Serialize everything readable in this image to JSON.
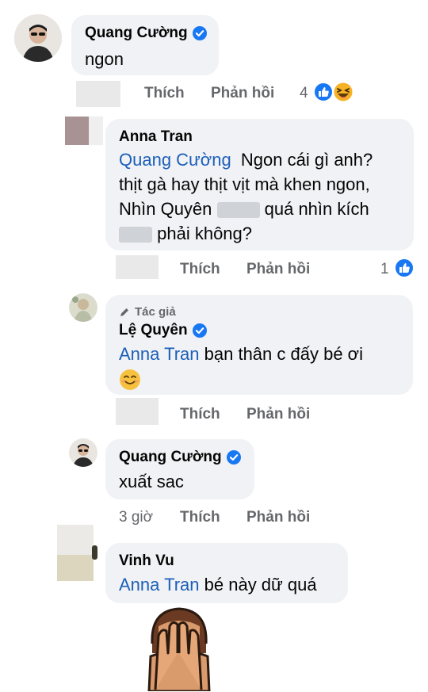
{
  "comments": [
    {
      "author": "Quang Cường",
      "verified": true,
      "text": "ngon",
      "actions": {
        "like": "Thích",
        "reply": "Phản hồi"
      },
      "reaction_count": "4",
      "reactions": [
        "like-icon",
        "haha-icon"
      ]
    },
    {
      "author": "Anna Tran",
      "mention": "Quang Cường",
      "line1": "Ngon cái gì anh?",
      "line2": "thịt gà hay thịt vịt mà khen ngon,",
      "line3a": "Nhìn Quyên ",
      "line3b": " quá nhìn kích",
      "line4": "phải không?",
      "actions": {
        "like": "Thích",
        "reply": "Phản hồi"
      },
      "reaction_count": "1",
      "reactions": [
        "like-icon"
      ]
    },
    {
      "badge": "Tác giả",
      "author": "Lệ Quyên",
      "verified": true,
      "mention": "Anna Tran",
      "text": "bạn thân c đấy bé ơi",
      "emoji": "😊",
      "actions": {
        "like": "Thích",
        "reply": "Phản hồi"
      }
    },
    {
      "author": "Quang Cường",
      "verified": true,
      "text": "xuất sac",
      "time": "3 giờ",
      "actions": {
        "like": "Thích",
        "reply": "Phản hồi"
      }
    },
    {
      "author": "Vinh Vu",
      "mention": "Anna Tran",
      "text": "bé này dữ quá",
      "sticker": "face-palm-sticker"
    }
  ],
  "colors": {
    "mention": "#1c5fb8",
    "bubble": "#f0f2f5",
    "meta": "#65676b",
    "verified": "#1877f2"
  }
}
